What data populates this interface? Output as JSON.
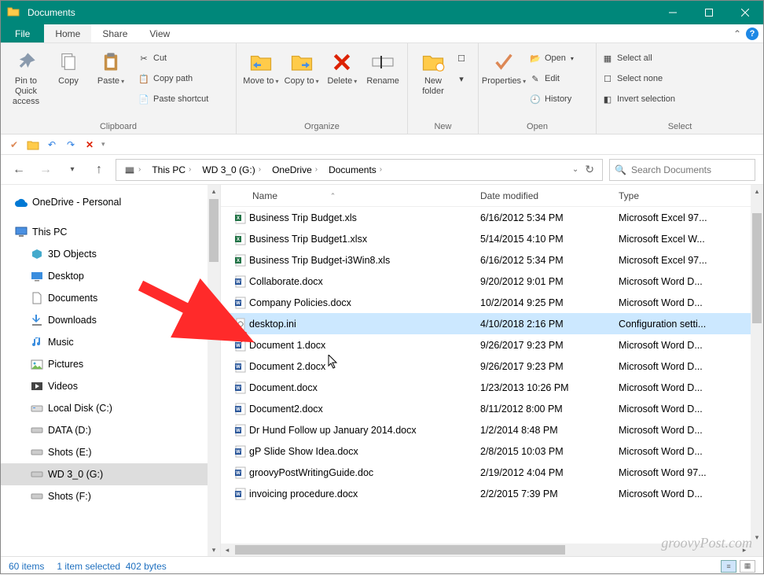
{
  "window": {
    "title": "Documents"
  },
  "menutabs": {
    "file": "File",
    "home": "Home",
    "share": "Share",
    "view": "View"
  },
  "ribbon": {
    "clipboard": {
      "label": "Clipboard",
      "pin": "Pin to Quick access",
      "copy": "Copy",
      "paste": "Paste",
      "cut": "Cut",
      "copypath": "Copy path",
      "pasteshortcut": "Paste shortcut"
    },
    "organize": {
      "label": "Organize",
      "moveto": "Move to",
      "copyto": "Copy to",
      "delete": "Delete",
      "rename": "Rename"
    },
    "new": {
      "label": "New",
      "newfolder": "New folder"
    },
    "open": {
      "label": "Open",
      "properties": "Properties",
      "open": "Open",
      "edit": "Edit",
      "history": "History"
    },
    "select": {
      "label": "Select",
      "selectall": "Select all",
      "selectnone": "Select none",
      "invert": "Invert selection"
    }
  },
  "breadcrumb": {
    "items": [
      "This PC",
      "WD 3_0 (G:)",
      "OneDrive",
      "Documents"
    ]
  },
  "search": {
    "placeholder": "Search Documents"
  },
  "sidebar": {
    "onedrive": "OneDrive - Personal",
    "thispc": "This PC",
    "items": [
      "3D Objects",
      "Desktop",
      "Documents",
      "Downloads",
      "Music",
      "Pictures",
      "Videos",
      "Local Disk (C:)",
      "DATA (D:)",
      "Shots (E:)",
      "WD 3_0 (G:)",
      "Shots (F:)"
    ]
  },
  "columns": {
    "name": "Name",
    "date": "Date modified",
    "type": "Type"
  },
  "files": [
    {
      "icon": "xls",
      "name": "Business Trip Budget.xls",
      "date": "6/16/2012 5:34 PM",
      "type": "Microsoft Excel 97..."
    },
    {
      "icon": "xlsx",
      "name": "Business Trip Budget1.xlsx",
      "date": "5/14/2015 4:10 PM",
      "type": "Microsoft Excel W..."
    },
    {
      "icon": "xls",
      "name": "Business Trip Budget-i3Win8.xls",
      "date": "6/16/2012 5:34 PM",
      "type": "Microsoft Excel 97..."
    },
    {
      "icon": "docx",
      "name": "Collaborate.docx",
      "date": "9/20/2012 9:01 PM",
      "type": "Microsoft Word D..."
    },
    {
      "icon": "docx",
      "name": "Company Policies.docx",
      "date": "10/2/2014 9:25 PM",
      "type": "Microsoft Word D..."
    },
    {
      "icon": "ini",
      "name": "desktop.ini",
      "date": "4/10/2018 2:16 PM",
      "type": "Configuration setti...",
      "selected": true
    },
    {
      "icon": "docx",
      "name": "Document 1.docx",
      "date": "9/26/2017 9:23 PM",
      "type": "Microsoft Word D..."
    },
    {
      "icon": "docx",
      "name": "Document 2.docx",
      "date": "9/26/2017 9:23 PM",
      "type": "Microsoft Word D..."
    },
    {
      "icon": "docx",
      "name": "Document.docx",
      "date": "1/23/2013 10:26 PM",
      "type": "Microsoft Word D..."
    },
    {
      "icon": "docx",
      "name": "Document2.docx",
      "date": "8/11/2012 8:00 PM",
      "type": "Microsoft Word D..."
    },
    {
      "icon": "docx",
      "name": "Dr Hund Follow up January 2014.docx",
      "date": "1/2/2014 8:48 PM",
      "type": "Microsoft Word D..."
    },
    {
      "icon": "docx",
      "name": "gP Slide Show Idea.docx",
      "date": "2/8/2015 10:03 PM",
      "type": "Microsoft Word D..."
    },
    {
      "icon": "doc",
      "name": "groovyPostWritingGuide.doc",
      "date": "2/19/2012 4:04 PM",
      "type": "Microsoft Word 97..."
    },
    {
      "icon": "docx",
      "name": "invoicing procedure.docx",
      "date": "2/2/2015 7:39 PM",
      "type": "Microsoft Word D..."
    }
  ],
  "status": {
    "items": "60 items",
    "selected": "1 item selected",
    "size": "402 bytes"
  },
  "watermark": "groovyPost.com"
}
